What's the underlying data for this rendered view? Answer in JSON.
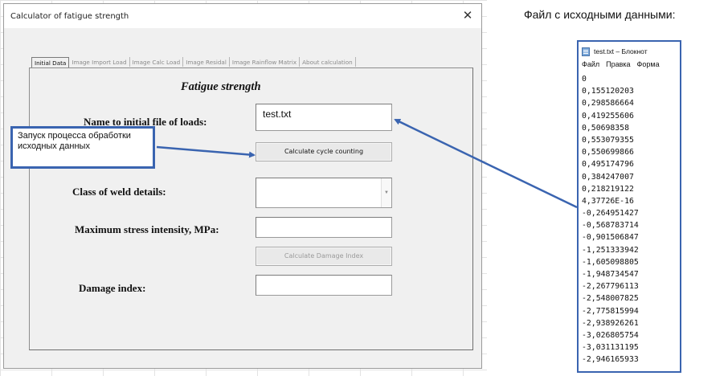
{
  "window": {
    "title": "Calculator of fatigue strength",
    "close_icon": "close-icon"
  },
  "tabs": [
    {
      "label": "Initial Data",
      "active": true
    },
    {
      "label": "Image Import Load",
      "active": false
    },
    {
      "label": "Image Calc Load",
      "active": false
    },
    {
      "label": "Image Residal",
      "active": false
    },
    {
      "label": "Image Rainflow Matrix",
      "active": false
    },
    {
      "label": "About calculation",
      "active": false
    }
  ],
  "form": {
    "heading": "Fatigue strength",
    "file_label": "Name to initial file of loads:",
    "file_value": "test.txt",
    "calc_cycle_button": "Calculate cycle counting",
    "weld_label": "Class of weld details:",
    "weld_value": "",
    "stress_label": "Maximum stress intensity, MPa:",
    "stress_value": "",
    "calc_damage_button": "Calculate Damage Index",
    "damage_label": "Damage index:",
    "damage_value": ""
  },
  "callout": {
    "text": "Запуск процесса обработки исходных данных"
  },
  "source_file": {
    "heading": "Файл с исходными данными:",
    "window_title": "test.txt – Блокнот",
    "menu": [
      "Файл",
      "Правка",
      "Форма"
    ],
    "lines": [
      "0",
      "0,155120203",
      "0,298586664",
      "0,419255606",
      "0,50698358",
      "0,553079355",
      "0,550699866",
      "0,495174796",
      "0,384247007",
      "0,218219122",
      "4,37726E-16",
      "-0,264951427",
      "-0,568783714",
      "-0,901506847",
      "-1,251333942",
      "-1,605098805",
      "-1,948734547",
      "-2,267796113",
      "-2,548007825",
      "-2,775815994",
      "-2,938926261",
      "-3,026805754",
      "-3,031131195",
      "-2,946165933"
    ]
  },
  "colors": {
    "accent": "#3a64b0",
    "dialog_bg": "#f0f0f0"
  }
}
